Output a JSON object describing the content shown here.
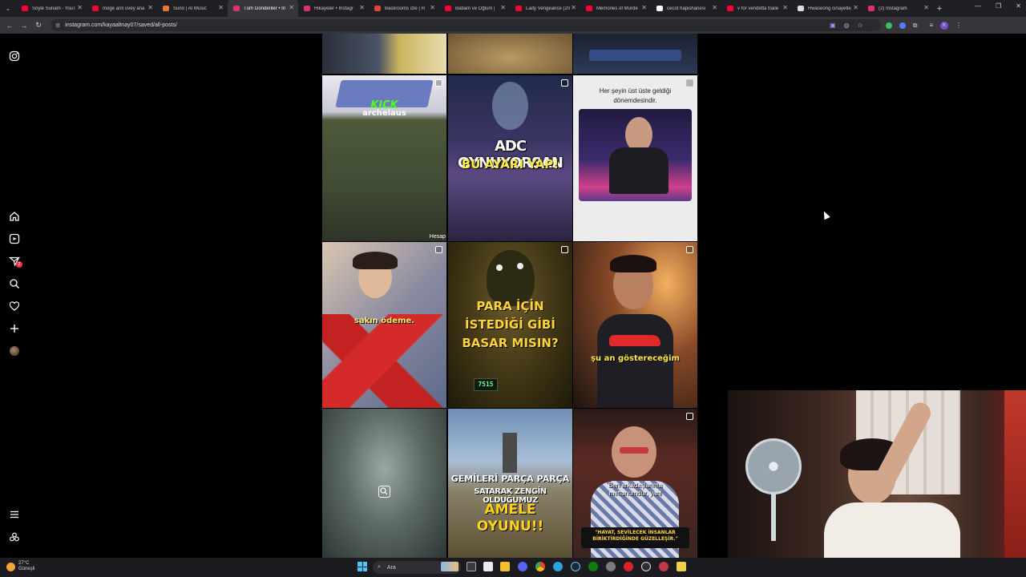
{
  "browser": {
    "tabs": [
      {
        "title": "Söyle Sunam - YouT",
        "icon": "youtube-icon",
        "color": "#ff0033"
      },
      {
        "title": "möge anlı üvey ana",
        "icon": "youtube-icon",
        "color": "#ff0033"
      },
      {
        "title": "Suno | AI Music",
        "icon": "suno-icon",
        "color": "#e8772e"
      },
      {
        "title": "Tüm Gönderiler • In",
        "icon": "instagram-icon",
        "color": "#e1306c",
        "active": true
      },
      {
        "title": "Hikayeler • Instagr",
        "icon": "instagram-icon",
        "color": "#e1306c"
      },
      {
        "title": "Backrooms izle | H",
        "icon": "site-icon",
        "color": "#d9483b"
      },
      {
        "title": "Babam ve Oğlum |",
        "icon": "youtube-icon",
        "color": "#ff0033"
      },
      {
        "title": "Lady Vengeance (20",
        "icon": "youtube-icon",
        "color": "#ff0033"
      },
      {
        "title": "Memories of Murde",
        "icon": "youtube-icon",
        "color": "#ff0033"
      },
      {
        "title": "cecot hapishanesi",
        "icon": "google-icon",
        "color": "#ffffff"
      },
      {
        "title": "v for vendetta traile",
        "icon": "youtube-icon",
        "color": "#ff0033"
      },
      {
        "title": "Hwaseong cinayetle",
        "icon": "doc-icon",
        "color": "#dddddd"
      },
      {
        "title": "(2) Instagram",
        "icon": "instagram-icon",
        "color": "#e1306c"
      }
    ],
    "new_tab": "+",
    "url": "instagram.com/kayaaltnay07/saved/all-posts/",
    "profile_letter": "K"
  },
  "sidebar": {
    "notif_count": "2",
    "items": [
      "instagram-logo-icon",
      "home-icon",
      "reels-icon",
      "messages-icon",
      "search-icon",
      "heart-icon",
      "create-icon",
      "avatar",
      "menu-icon",
      "threads-icon"
    ]
  },
  "grid": {
    "top_row": {},
    "row1": {
      "kick_label": "KICK",
      "kick_name": "archelaus",
      "kick_corner": "Hesap",
      "adc_line1": "ADC OYNUYORSAN",
      "adc_line2": "BU AYARI YAP!",
      "quote_line1": "Her şeyin üst üste geldiği",
      "quote_line2": "dönemdesindir."
    },
    "row2": {
      "caption_left": "sakın ödeme.",
      "para_line1": "PARA İÇİN",
      "para_line2": "İSTEDİĞİ GİBİ",
      "para_line3": "BASAR MISIN?",
      "keypad_value": "7515",
      "caption_right": "şu an göstereceğim"
    },
    "row3": {
      "ship_line1": "GEMİLERİ PARÇA PARÇA",
      "ship_line2": "SATARAK ZENGİN OLDUĞUMUZ",
      "ship_line3": "AMELE",
      "ship_line4": "OYUNU!!",
      "man_line1": "Ben arkadaşlarıma",
      "man_line2": "meftunumdur, yani",
      "man_quote": "\"HAYAT, SEVİLECEK İNSANLAR BİRİKTİRDİĞİNDE GÜZELLEŞİR.\""
    }
  },
  "taskbar": {
    "temperature": "27°C",
    "weather": "Güneşli",
    "search_placeholder": "Ara"
  }
}
